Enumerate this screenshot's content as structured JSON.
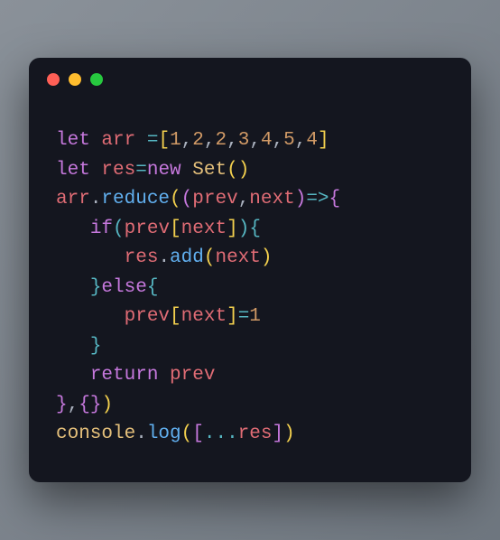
{
  "window": {
    "buttons": [
      "close",
      "minimize",
      "maximize"
    ]
  },
  "code": {
    "lines": [
      {
        "tokens": [
          {
            "t": "let",
            "c": "kw"
          },
          {
            "t": " ",
            "c": ""
          },
          {
            "t": "arr",
            "c": "var"
          },
          {
            "t": " ",
            "c": ""
          },
          {
            "t": "=",
            "c": "op"
          },
          {
            "t": "[",
            "c": "paren"
          },
          {
            "t": "1",
            "c": "num"
          },
          {
            "t": ",",
            "c": "punc"
          },
          {
            "t": "2",
            "c": "num"
          },
          {
            "t": ",",
            "c": "punc"
          },
          {
            "t": "2",
            "c": "num"
          },
          {
            "t": ",",
            "c": "punc"
          },
          {
            "t": "3",
            "c": "num"
          },
          {
            "t": ",",
            "c": "punc"
          },
          {
            "t": "4",
            "c": "num"
          },
          {
            "t": ",",
            "c": "punc"
          },
          {
            "t": "5",
            "c": "num"
          },
          {
            "t": ",",
            "c": "punc"
          },
          {
            "t": "4",
            "c": "num"
          },
          {
            "t": "]",
            "c": "paren"
          }
        ]
      },
      {
        "tokens": [
          {
            "t": "let",
            "c": "kw"
          },
          {
            "t": " ",
            "c": ""
          },
          {
            "t": "res",
            "c": "var"
          },
          {
            "t": "=",
            "c": "op"
          },
          {
            "t": "new",
            "c": "kw"
          },
          {
            "t": " ",
            "c": ""
          },
          {
            "t": "Set",
            "c": "id"
          },
          {
            "t": "(",
            "c": "paren"
          },
          {
            "t": ")",
            "c": "paren"
          }
        ]
      },
      {
        "tokens": [
          {
            "t": "arr",
            "c": "var"
          },
          {
            "t": ".",
            "c": "punc"
          },
          {
            "t": "reduce",
            "c": "fn"
          },
          {
            "t": "(",
            "c": "paren"
          },
          {
            "t": "(",
            "c": "paren2"
          },
          {
            "t": "prev",
            "c": "var"
          },
          {
            "t": ",",
            "c": "punc"
          },
          {
            "t": "next",
            "c": "var"
          },
          {
            "t": ")",
            "c": "paren2"
          },
          {
            "t": "=>",
            "c": "op"
          },
          {
            "t": "{",
            "c": "paren2"
          }
        ]
      },
      {
        "tokens": [
          {
            "t": "   ",
            "c": ""
          },
          {
            "t": "if",
            "c": "kw"
          },
          {
            "t": "(",
            "c": "paren3"
          },
          {
            "t": "prev",
            "c": "var"
          },
          {
            "t": "[",
            "c": "paren"
          },
          {
            "t": "next",
            "c": "var"
          },
          {
            "t": "]",
            "c": "paren"
          },
          {
            "t": ")",
            "c": "paren3"
          },
          {
            "t": "{",
            "c": "paren3"
          }
        ]
      },
      {
        "tokens": [
          {
            "t": "      ",
            "c": ""
          },
          {
            "t": "res",
            "c": "var"
          },
          {
            "t": ".",
            "c": "punc"
          },
          {
            "t": "add",
            "c": "fn"
          },
          {
            "t": "(",
            "c": "paren"
          },
          {
            "t": "next",
            "c": "var"
          },
          {
            "t": ")",
            "c": "paren"
          }
        ]
      },
      {
        "tokens": [
          {
            "t": "   ",
            "c": ""
          },
          {
            "t": "}",
            "c": "paren3"
          },
          {
            "t": "else",
            "c": "kw"
          },
          {
            "t": "{",
            "c": "paren3"
          }
        ]
      },
      {
        "tokens": [
          {
            "t": "      ",
            "c": ""
          },
          {
            "t": "prev",
            "c": "var"
          },
          {
            "t": "[",
            "c": "paren"
          },
          {
            "t": "next",
            "c": "var"
          },
          {
            "t": "]",
            "c": "paren"
          },
          {
            "t": "=",
            "c": "op"
          },
          {
            "t": "1",
            "c": "num"
          }
        ]
      },
      {
        "tokens": [
          {
            "t": "   ",
            "c": ""
          },
          {
            "t": "}",
            "c": "paren3"
          }
        ]
      },
      {
        "tokens": [
          {
            "t": "   ",
            "c": ""
          },
          {
            "t": "return",
            "c": "kw"
          },
          {
            "t": " ",
            "c": ""
          },
          {
            "t": "prev",
            "c": "var"
          }
        ]
      },
      {
        "tokens": [
          {
            "t": "}",
            "c": "paren2"
          },
          {
            "t": ",",
            "c": "punc"
          },
          {
            "t": "{",
            "c": "paren2"
          },
          {
            "t": "}",
            "c": "paren2"
          },
          {
            "t": ")",
            "c": "paren"
          }
        ]
      },
      {
        "tokens": [
          {
            "t": "console",
            "c": "id"
          },
          {
            "t": ".",
            "c": "punc"
          },
          {
            "t": "log",
            "c": "fn"
          },
          {
            "t": "(",
            "c": "paren"
          },
          {
            "t": "[",
            "c": "paren2"
          },
          {
            "t": "...",
            "c": "op"
          },
          {
            "t": "res",
            "c": "var"
          },
          {
            "t": "]",
            "c": "paren2"
          },
          {
            "t": ")",
            "c": "paren"
          }
        ]
      }
    ]
  }
}
